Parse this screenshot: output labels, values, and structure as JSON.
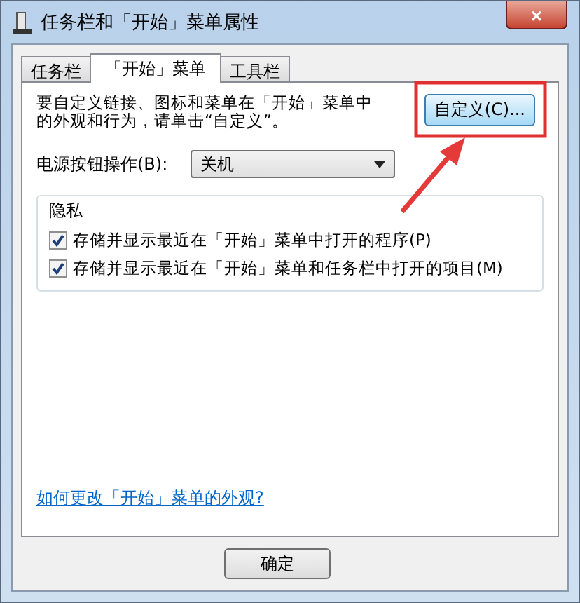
{
  "window": {
    "title": "任务栏和「开始」菜单属性",
    "close": "×"
  },
  "tabs": [
    {
      "label": "任务栏",
      "selected": false
    },
    {
      "label": "「开始」菜单",
      "selected": true
    },
    {
      "label": "工具栏",
      "selected": false
    }
  ],
  "intro": "要自定义链接、图标和菜单在「开始」菜单中的外观和行为，请单击“自定义”。",
  "customize_button": "自定义(C)...",
  "power": {
    "label": "电源按钮操作(B):",
    "value": "关机"
  },
  "privacy": {
    "title": "隐私",
    "options": [
      {
        "label": "存储并显示最近在「开始」菜单中打开的程序(P)",
        "checked": true
      },
      {
        "label": "存储并显示最近在「开始」菜单和任务栏中打开的项目(M)",
        "checked": true
      }
    ]
  },
  "help_link": "如何更改「开始」菜单的外观?",
  "buttons": [
    "确定"
  ]
}
